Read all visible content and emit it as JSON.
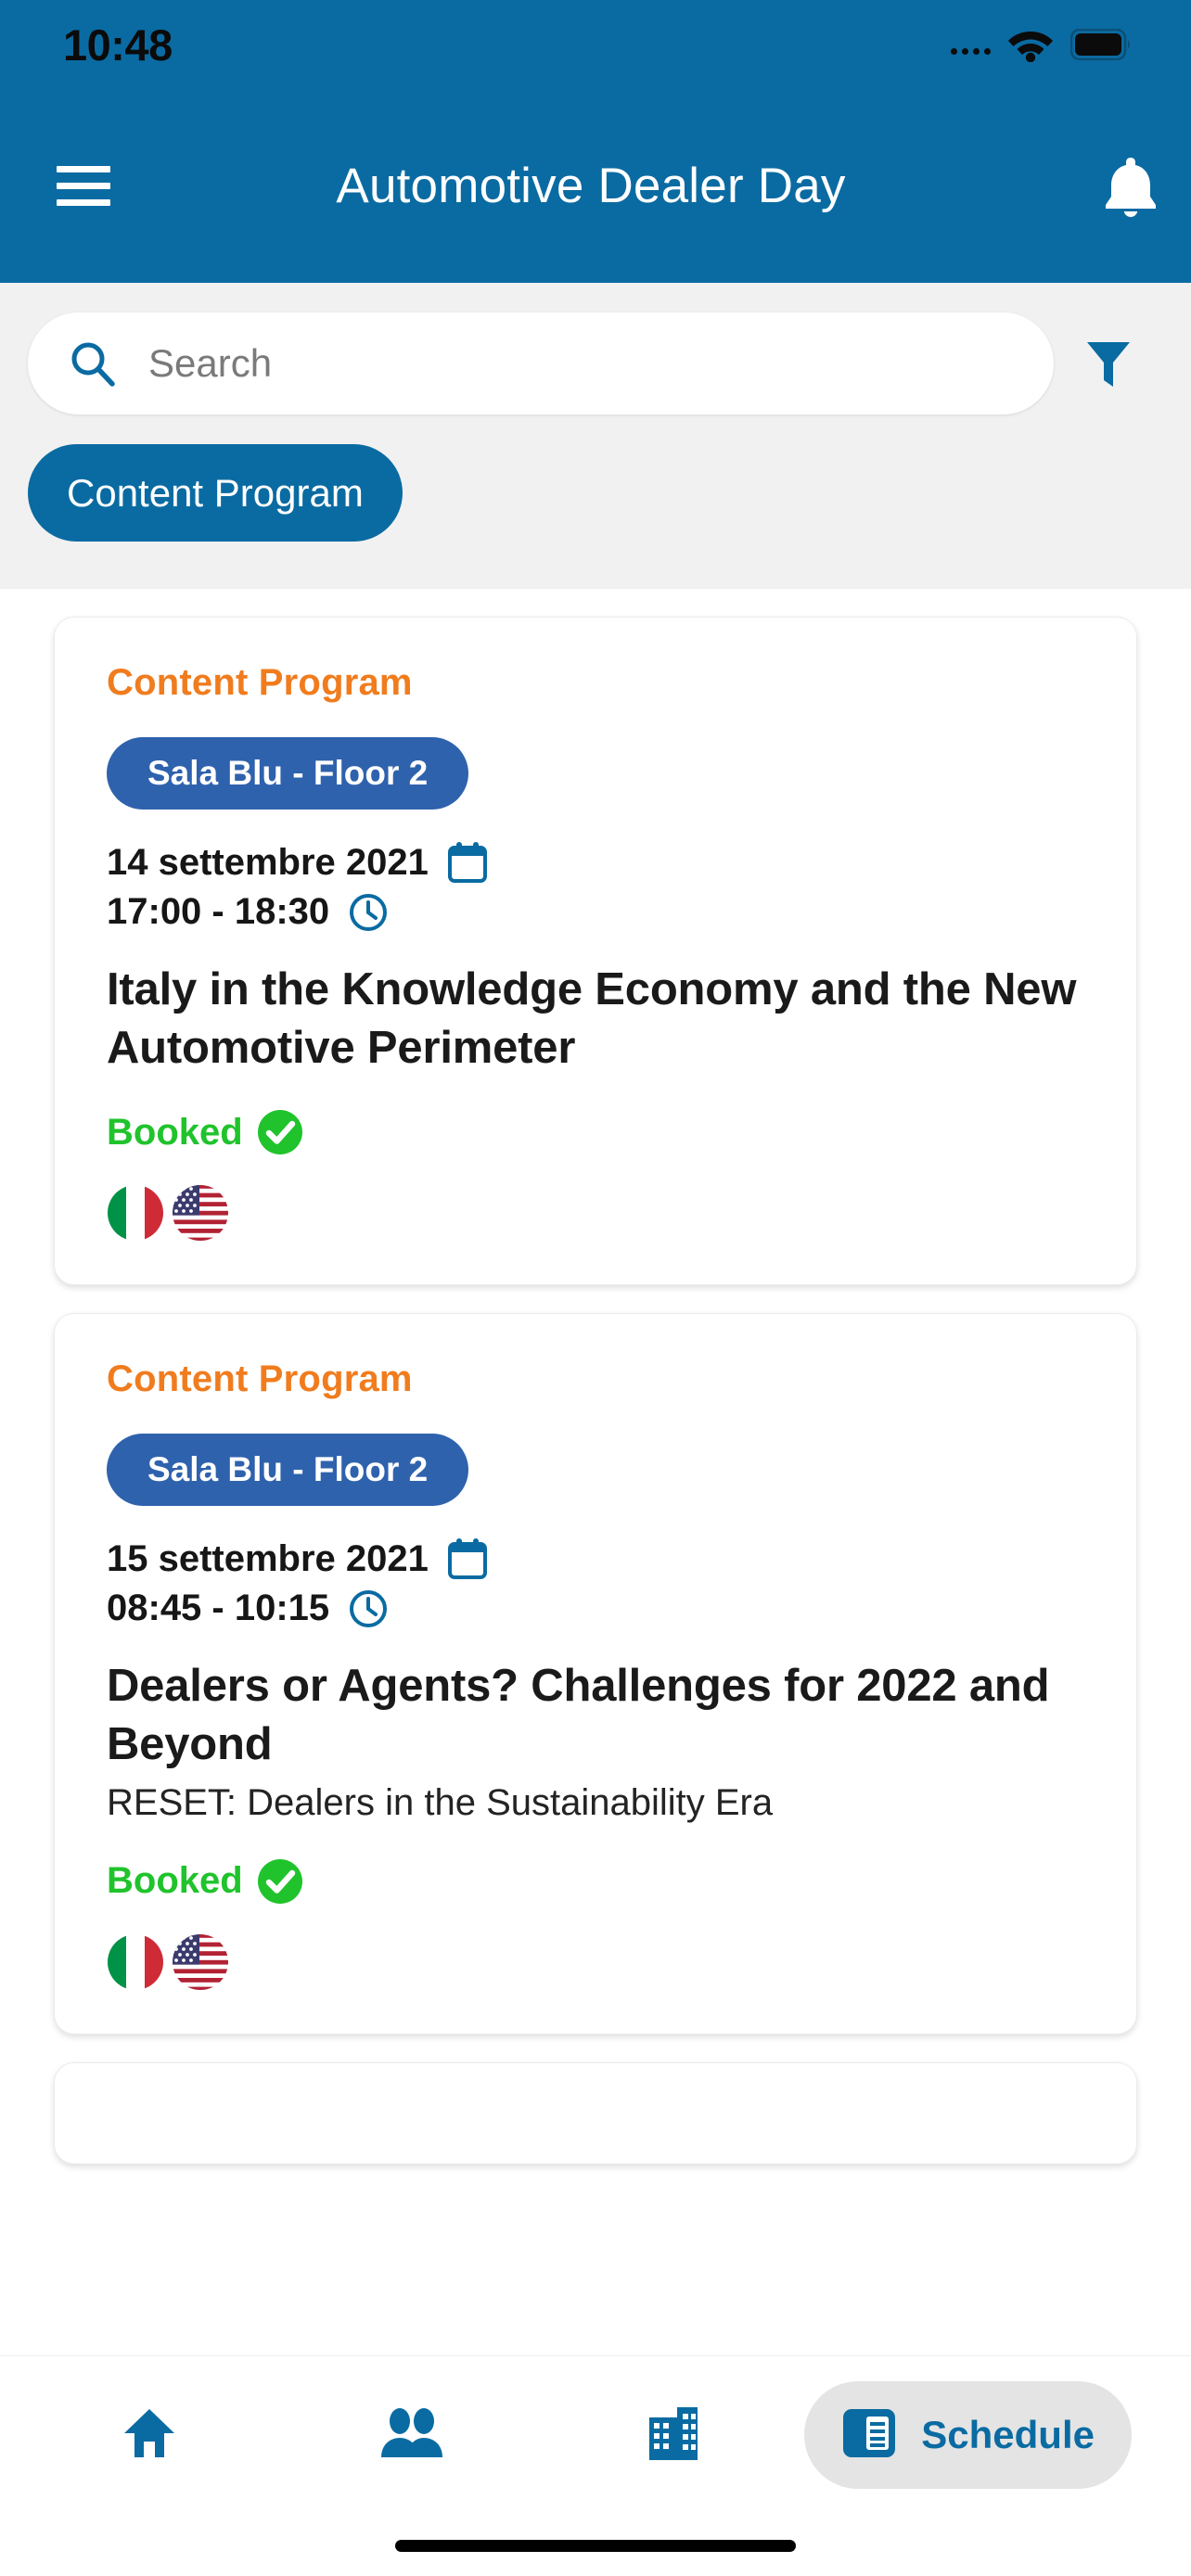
{
  "status_bar": {
    "time": "10:48",
    "icons": [
      "signal-dots-icon",
      "wifi-icon",
      "battery-icon"
    ]
  },
  "header": {
    "menu_icon": "hamburger-menu-icon",
    "title": "Automotive Dealer Day",
    "notification_icon": "bell-icon",
    "background_color": "#0a6ba2"
  },
  "search": {
    "icon": "search-icon",
    "placeholder": "Search",
    "value": "",
    "filter_icon": "funnel-filter-icon"
  },
  "filter_chips": [
    {
      "label": "Content Program",
      "selected": true
    }
  ],
  "cards": [
    {
      "category": "Content Program",
      "room": "Sala Blu - Floor 2",
      "date": "14 settembre 2021",
      "date_icon": "calendar-icon",
      "time": "17:00 - 18:30",
      "time_icon": "clock-icon",
      "title": "Italy in the Knowledge Economy and the New Automotive Perimeter",
      "subtitle": "",
      "status": "Booked",
      "status_icon": "check-circle-icon",
      "languages": [
        "italy-flag-icon",
        "usa-flag-icon"
      ]
    },
    {
      "category": "Content Program",
      "room": "Sala Blu - Floor 2",
      "date": "15 settembre 2021",
      "date_icon": "calendar-icon",
      "time": "08:45 - 10:15",
      "time_icon": "clock-icon",
      "title": "Dealers or Agents? Challenges for 2022 and Beyond",
      "subtitle": "RESET: Dealers in the Sustainability Era",
      "status": "Booked",
      "status_icon": "check-circle-icon",
      "languages": [
        "italy-flag-icon",
        "usa-flag-icon"
      ]
    }
  ],
  "bottom_nav": {
    "items": [
      {
        "icon": "home-icon",
        "label": "",
        "active": false
      },
      {
        "icon": "people-icon",
        "label": "",
        "active": false
      },
      {
        "icon": "building-icon",
        "label": "",
        "active": false
      },
      {
        "icon": "schedule-icon",
        "label": "Schedule",
        "active": true
      }
    ]
  },
  "colors": {
    "brand_blue": "#0a6ba2",
    "accent_orange": "#f07c1e",
    "room_blue": "#2f62ad",
    "booked_green": "#20c32c",
    "page_background": "#ffffff",
    "filter_background": "#f1f1f1"
  }
}
